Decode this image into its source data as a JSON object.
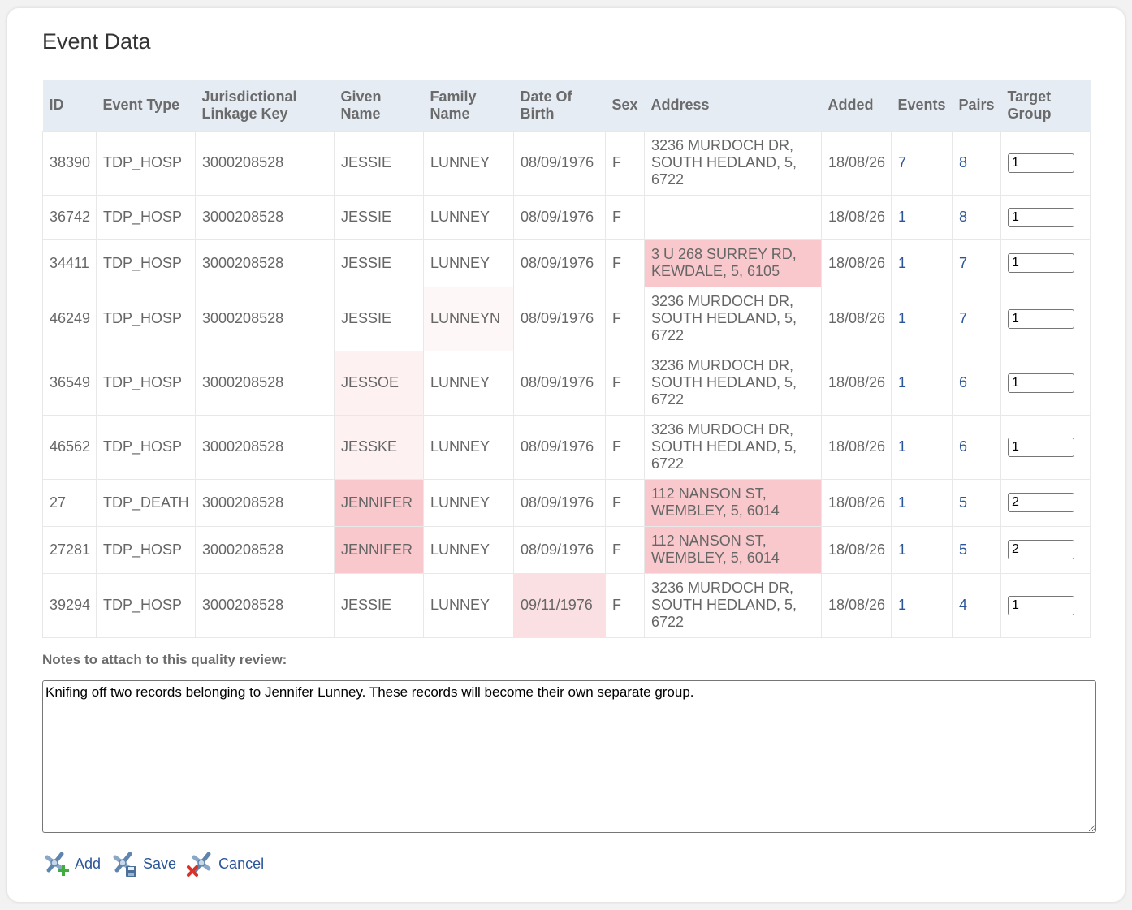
{
  "page": {
    "title": "Event Data"
  },
  "table": {
    "columns": [
      "ID",
      "Event Type",
      "Jurisdictional Linkage Key",
      "Given Name",
      "Family Name",
      "Date Of Birth",
      "Sex",
      "Address",
      "Added",
      "Events",
      "Pairs",
      "Target Group"
    ],
    "rows": [
      {
        "id": "38390",
        "event_type": "TDP_HOSP",
        "linkage_key": "3000208528",
        "given_name": "JESSIE",
        "family_name": "LUNNEY",
        "dob": "08/09/1976",
        "sex": "F",
        "address": "3236 MURDOCH DR, SOUTH HEDLAND, 5, 6722",
        "added": "18/08/26",
        "events": "7",
        "pairs": "8",
        "target_group": "1"
      },
      {
        "id": "36742",
        "event_type": "TDP_HOSP",
        "linkage_key": "3000208528",
        "given_name": "JESSIE",
        "family_name": "LUNNEY",
        "dob": "08/09/1976",
        "sex": "F",
        "address": "",
        "added": "18/08/26",
        "events": "1",
        "pairs": "8",
        "target_group": "1"
      },
      {
        "id": "34411",
        "event_type": "TDP_HOSP",
        "linkage_key": "3000208528",
        "given_name": "JESSIE",
        "family_name": "LUNNEY",
        "dob": "08/09/1976",
        "sex": "F",
        "address": "3 U 268 SURREY RD, KEWDALE, 5, 6105",
        "added": "18/08/26",
        "events": "1",
        "pairs": "7",
        "target_group": "1"
      },
      {
        "id": "46249",
        "event_type": "TDP_HOSP",
        "linkage_key": "3000208528",
        "given_name": "JESSIE",
        "family_name": "LUNNEYN",
        "dob": "08/09/1976",
        "sex": "F",
        "address": "3236 MURDOCH DR, SOUTH HEDLAND, 5, 6722",
        "added": "18/08/26",
        "events": "1",
        "pairs": "7",
        "target_group": "1"
      },
      {
        "id": "36549",
        "event_type": "TDP_HOSP",
        "linkage_key": "3000208528",
        "given_name": "JESSOE",
        "family_name": "LUNNEY",
        "dob": "08/09/1976",
        "sex": "F",
        "address": "3236 MURDOCH DR, SOUTH HEDLAND, 5, 6722",
        "added": "18/08/26",
        "events": "1",
        "pairs": "6",
        "target_group": "1"
      },
      {
        "id": "46562",
        "event_type": "TDP_HOSP",
        "linkage_key": "3000208528",
        "given_name": "JESSKE",
        "family_name": "LUNNEY",
        "dob": "08/09/1976",
        "sex": "F",
        "address": "3236 MURDOCH DR, SOUTH HEDLAND, 5, 6722",
        "added": "18/08/26",
        "events": "1",
        "pairs": "6",
        "target_group": "1"
      },
      {
        "id": "27",
        "event_type": "TDP_DEATH",
        "linkage_key": "3000208528",
        "given_name": "JENNIFER",
        "family_name": "LUNNEY",
        "dob": "08/09/1976",
        "sex": "F",
        "address": "112 NANSON ST, WEMBLEY, 5, 6014",
        "added": "18/08/26",
        "events": "1",
        "pairs": "5",
        "target_group": "2"
      },
      {
        "id": "27281",
        "event_type": "TDP_HOSP",
        "linkage_key": "3000208528",
        "given_name": "JENNIFER",
        "family_name": "LUNNEY",
        "dob": "08/09/1976",
        "sex": "F",
        "address": "112 NANSON ST, WEMBLEY, 5, 6014",
        "added": "18/08/26",
        "events": "1",
        "pairs": "5",
        "target_group": "2"
      },
      {
        "id": "39294",
        "event_type": "TDP_HOSP",
        "linkage_key": "3000208528",
        "given_name": "JESSIE",
        "family_name": "LUNNEY",
        "dob": "09/11/1976",
        "sex": "F",
        "address": "3236 MURDOCH DR, SOUTH HEDLAND, 5, 6722",
        "added": "18/08/26",
        "events": "1",
        "pairs": "4",
        "target_group": "1"
      }
    ]
  },
  "notes": {
    "label": "Notes to attach to this quality review:",
    "value": "Knifing off two records belonging to Jennifer Lunney. These records will become their own separate group."
  },
  "actions": {
    "add_label": "Add",
    "save_label": "Save",
    "cancel_label": "Cancel"
  },
  "colors": {
    "header_bg": "#e6ecf4",
    "link": "#2a5599",
    "highlight_strong": "#f8c8cc",
    "highlight_medium": "#fbe0e3",
    "highlight_light": "#fdf1f2",
    "highlight_faint": "#fef7f7"
  }
}
